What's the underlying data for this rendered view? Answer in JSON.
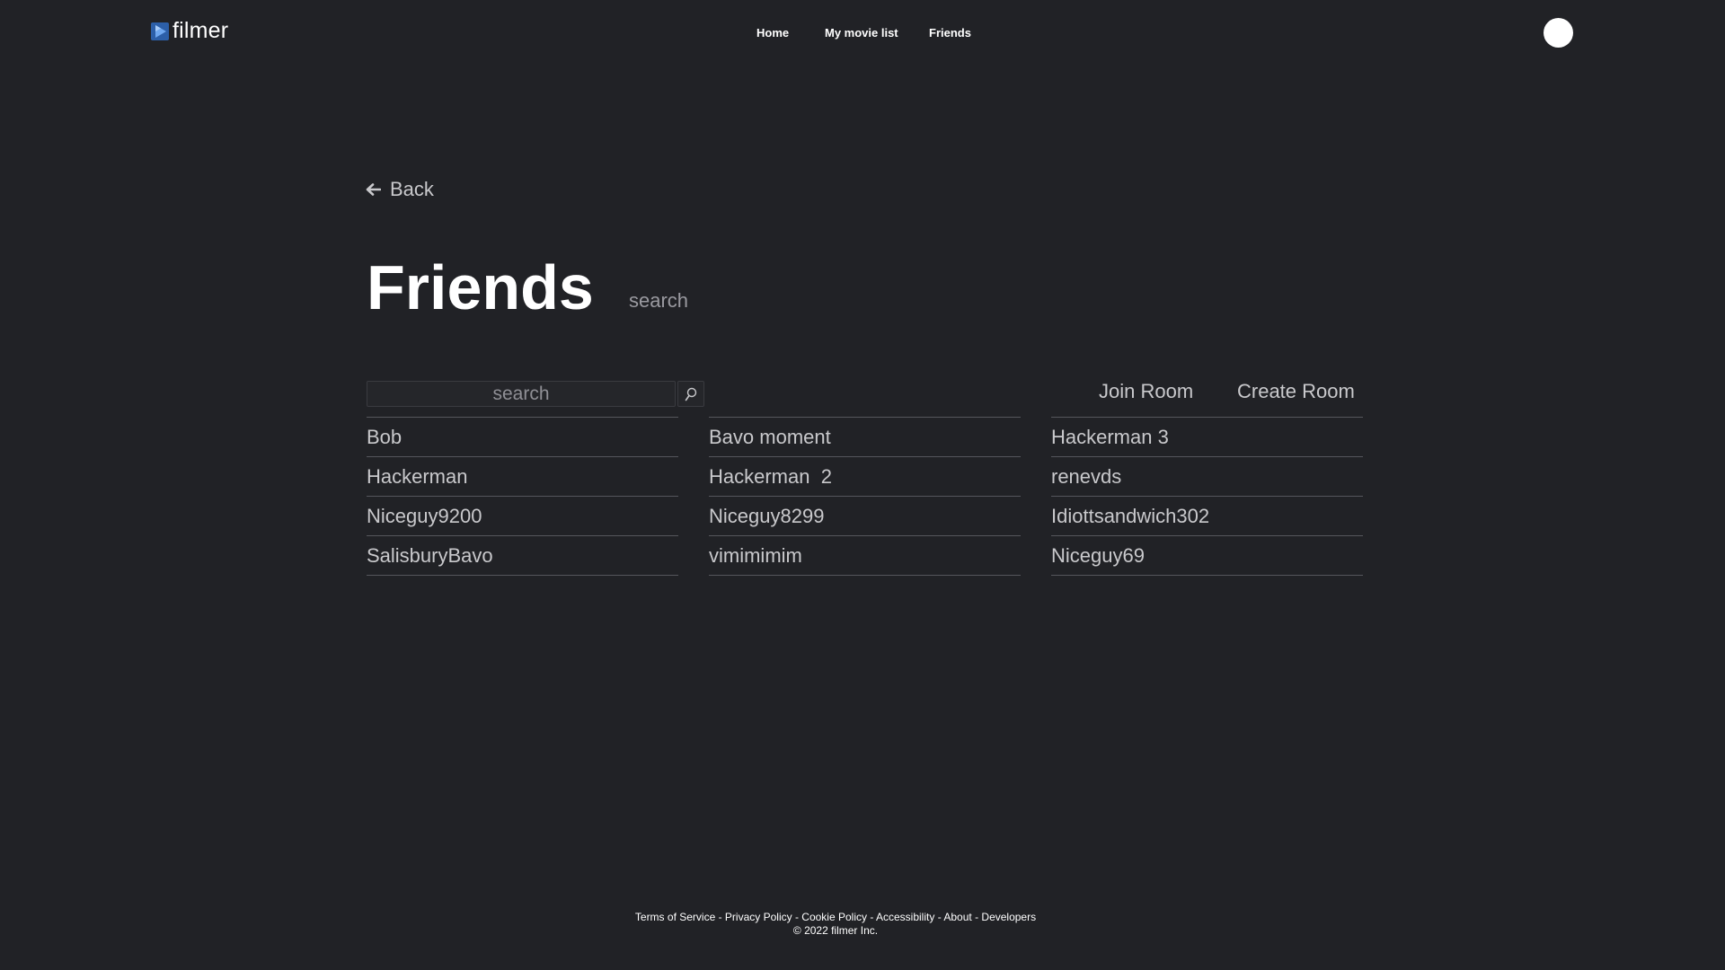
{
  "header": {
    "brand": "filmer",
    "logo_icon": "play-icon",
    "nav": {
      "home": "Home",
      "movie_list": "My movie list",
      "friends": "Friends"
    }
  },
  "back": {
    "label": "Back",
    "icon": "arrow-left-icon"
  },
  "main": {
    "title": "Friends",
    "title_search": "search",
    "search": {
      "placeholder": "search",
      "value": "",
      "icon": "search-icon"
    },
    "join_room": "Join Room",
    "create_room": "Create Room",
    "friends_columns": [
      [
        "Bob",
        "Hackerman",
        "Niceguy9200",
        "SalisburyBavo"
      ],
      [
        "Bavo moment",
        "Hackerman  2",
        "Niceguy8299",
        "vimimimim"
      ],
      [
        "Hackerman 3",
        "renevds",
        "Idiottsandwich302",
        "Niceguy69"
      ]
    ]
  },
  "footer": {
    "links": [
      "Terms of Service",
      "Privacy Policy",
      "Cookie Policy",
      "Accessibility",
      "About",
      "Developers"
    ],
    "separator": " - ",
    "copyright": "© 2022 filmer Inc."
  },
  "colors": {
    "background": "#212226",
    "text": "#ffffff",
    "muted_text": "#c9c9cc",
    "divider": "#55565c",
    "logo_accent": "#3f7fd6"
  }
}
